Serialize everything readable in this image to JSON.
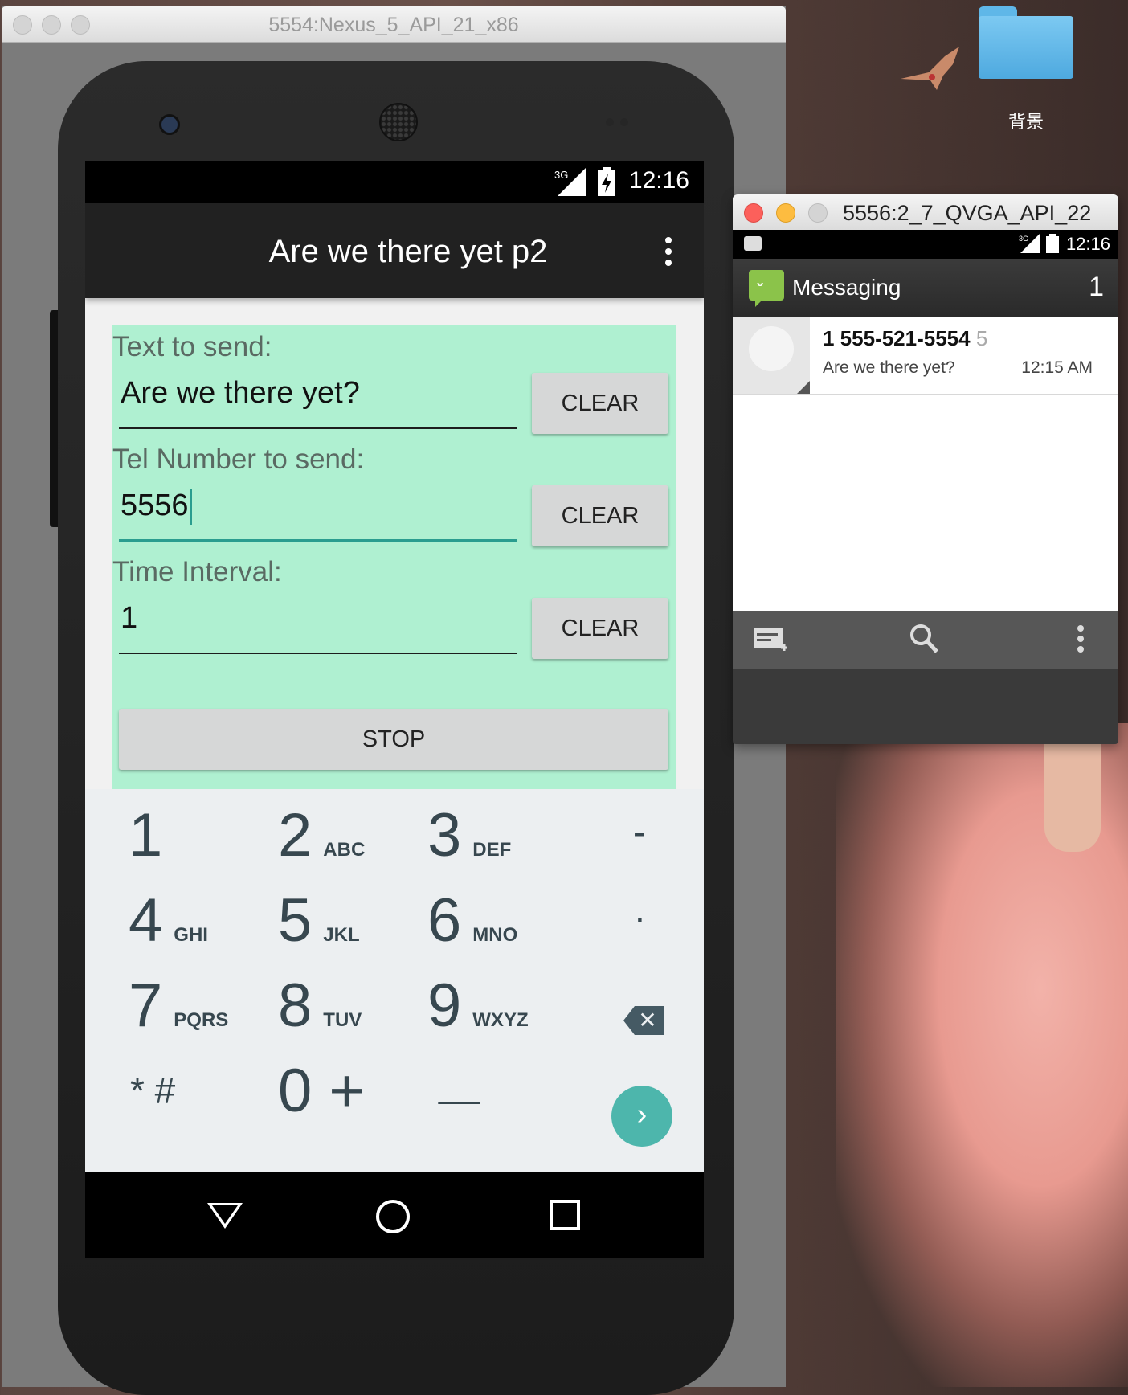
{
  "desktop": {
    "folder_label": "背景"
  },
  "emulator_main": {
    "window_title": "5554:Nexus_5_API_21_x86",
    "status_time": "12:16",
    "network": "3G",
    "app_title": "Are we there yet p2",
    "form": {
      "text_label": "Text to send:",
      "text_value": "Are we there yet?",
      "tel_label": "Tel Number to send:",
      "tel_value": "5556",
      "interval_label": "Time Interval:",
      "interval_value": "1",
      "clear_label": "CLEAR",
      "stop_label": "STOP"
    },
    "keypad": {
      "keys": [
        {
          "digit": "1",
          "letters": ""
        },
        {
          "digit": "2",
          "letters": "ABC"
        },
        {
          "digit": "3",
          "letters": "DEF"
        },
        {
          "digit": "-",
          "letters": ""
        },
        {
          "digit": "4",
          "letters": "GHI"
        },
        {
          "digit": "5",
          "letters": "JKL"
        },
        {
          "digit": "6",
          "letters": "MNO"
        },
        {
          "digit": ".",
          "letters": ""
        },
        {
          "digit": "7",
          "letters": "PQRS"
        },
        {
          "digit": "8",
          "letters": "TUV"
        },
        {
          "digit": "9",
          "letters": "WXYZ"
        },
        {
          "digit": "* #",
          "letters": ""
        },
        {
          "digit": "0 +",
          "letters": ""
        },
        {
          "digit": "__",
          "letters": ""
        }
      ],
      "go_glyph": "›",
      "delete_glyph": "✕"
    }
  },
  "emulator_secondary": {
    "window_title": "5556:2_7_QVGA_API_22",
    "status_time": "12:16",
    "network": "3G",
    "app_label": "Messaging",
    "unread_count": "1",
    "conversations": [
      {
        "from": "1 555-521-5554",
        "count": "5",
        "snippet": "Are we there yet?",
        "time": "12:15 AM"
      }
    ]
  },
  "colors": {
    "form_bg": "#aff0d1",
    "accent": "#4db6ac",
    "appbar": "#212121"
  }
}
